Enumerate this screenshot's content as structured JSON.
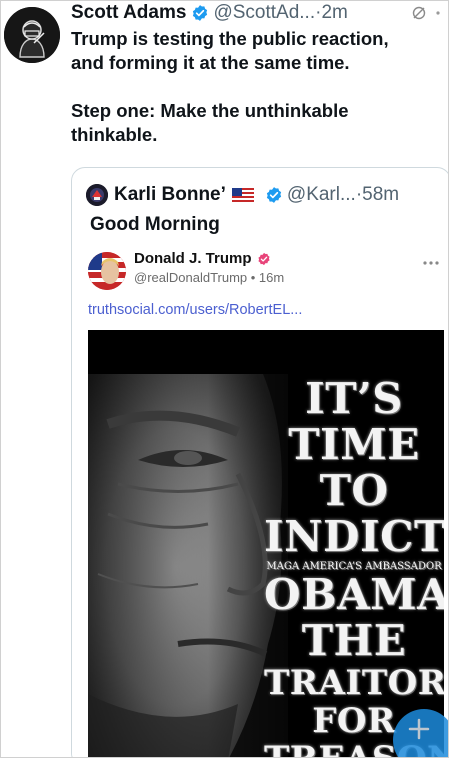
{
  "outer_tweet": {
    "author_name": "Scott Adams",
    "author_handle": "@ScottAd...",
    "time_sep": "·",
    "time": "2m",
    "body_line1": "Trump is testing the public reaction,",
    "body_line2": "and forming it at the same time.",
    "body_line3": "Step one: Make the unthinkable",
    "body_line4": "thinkable."
  },
  "quoted_tweet": {
    "author_name": "Karli Bonne’",
    "author_handle": "@Karl...",
    "time_sep": "·",
    "time": "58m",
    "body": "Good Morning"
  },
  "truth_post": {
    "author_name": "Donald J. Trump",
    "author_handle": "@realDonaldTrump • 16m",
    "link": "truthsocial.com/users/RobertEL..."
  },
  "meme": {
    "lines": [
      "IT’S",
      "TIME",
      "TO",
      "INDICT",
      "MAGA AMERICA’S AMBASSADOR",
      "OBAMA",
      "THE",
      "TRAITOR",
      "FOR",
      "TREASON"
    ]
  },
  "colors": {
    "verified": "#1d9bf0",
    "truth_verified": "#e8447a",
    "link": "#4b5fd0",
    "fab": "#1d8bdc"
  },
  "icons": [
    "verified-badge-icon",
    "mute-icon",
    "flag-us-icon",
    "more-icon",
    "plus-icon"
  ]
}
